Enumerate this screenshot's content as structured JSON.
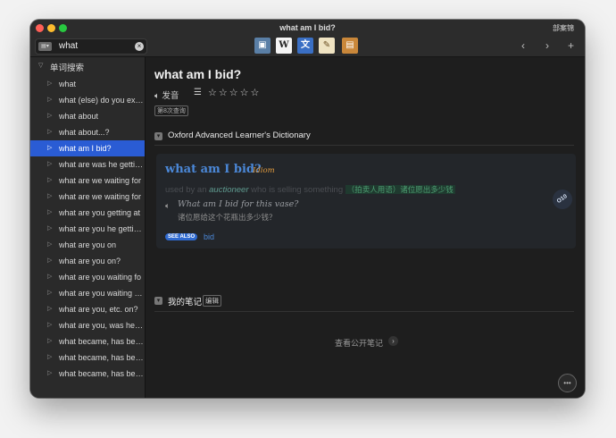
{
  "window": {
    "title": "what am I bid?",
    "right_label": "部案锦"
  },
  "toolbar": {
    "search_mode_icon": "list-dropdown-icon",
    "search_value": "what",
    "clear_icon": "clear-icon",
    "dict_icons": [
      {
        "name": "dictionary-book-icon",
        "glyph": "▣"
      },
      {
        "name": "wikipedia-icon",
        "glyph": "W"
      },
      {
        "name": "translate-icon",
        "glyph": "文"
      },
      {
        "name": "notes-book-icon",
        "glyph": "✎"
      },
      {
        "name": "brown-book-icon",
        "glyph": "▤"
      }
    ],
    "back_glyph": "‹",
    "forward_glyph": "›",
    "add_glyph": "+"
  },
  "sidebar": {
    "header": "单词搜索",
    "items": [
      "what",
      "what (else) do you exp...",
      "what about",
      "what about...?",
      "what am I bid?",
      "what are was he gettin...",
      "what are we waiting for",
      "what are we waiting for",
      "what are you getting at",
      "what are you he gettin...",
      "what are you on",
      "what are you on?",
      "what are you waiting fo",
      "what are you waiting fo...",
      "what are you, etc. on?",
      "what are you, was he,...",
      "what became, has bec...",
      "what became, has bec...",
      "what became, has bec..."
    ],
    "selected_index": 4
  },
  "main": {
    "headword": "what am I bid?",
    "pronounce_label": "发音",
    "stars": "☆☆☆☆☆",
    "lookup_count": "第8次查询",
    "dictionary_section": "Oxford Advanced Learner's Dictionary",
    "entry": {
      "word": "what am I bid?",
      "pos": "Idiom",
      "def_prefix": "used by an",
      "def_key": "auctioneer",
      "def_suffix": "who is selling something",
      "def_cn": "（拍卖人用语）诸位愿出多少钱",
      "example_en": "What am I bid for this vase?",
      "example_cn": "诸位愿给这个花瓶出多少钱？",
      "see_also_tag": "SEE ALSO",
      "see_also_link": "bid"
    },
    "oxford_badge": "O10",
    "notes_section": "我的笔记",
    "edit_label": "编辑",
    "public_notes_label": "查看公开笔记",
    "colors": {
      "accent": "#4b88d8",
      "selection": "#2a5cd4",
      "pos": "#e09a3e",
      "cn_highlight": "#4e9e72"
    }
  }
}
